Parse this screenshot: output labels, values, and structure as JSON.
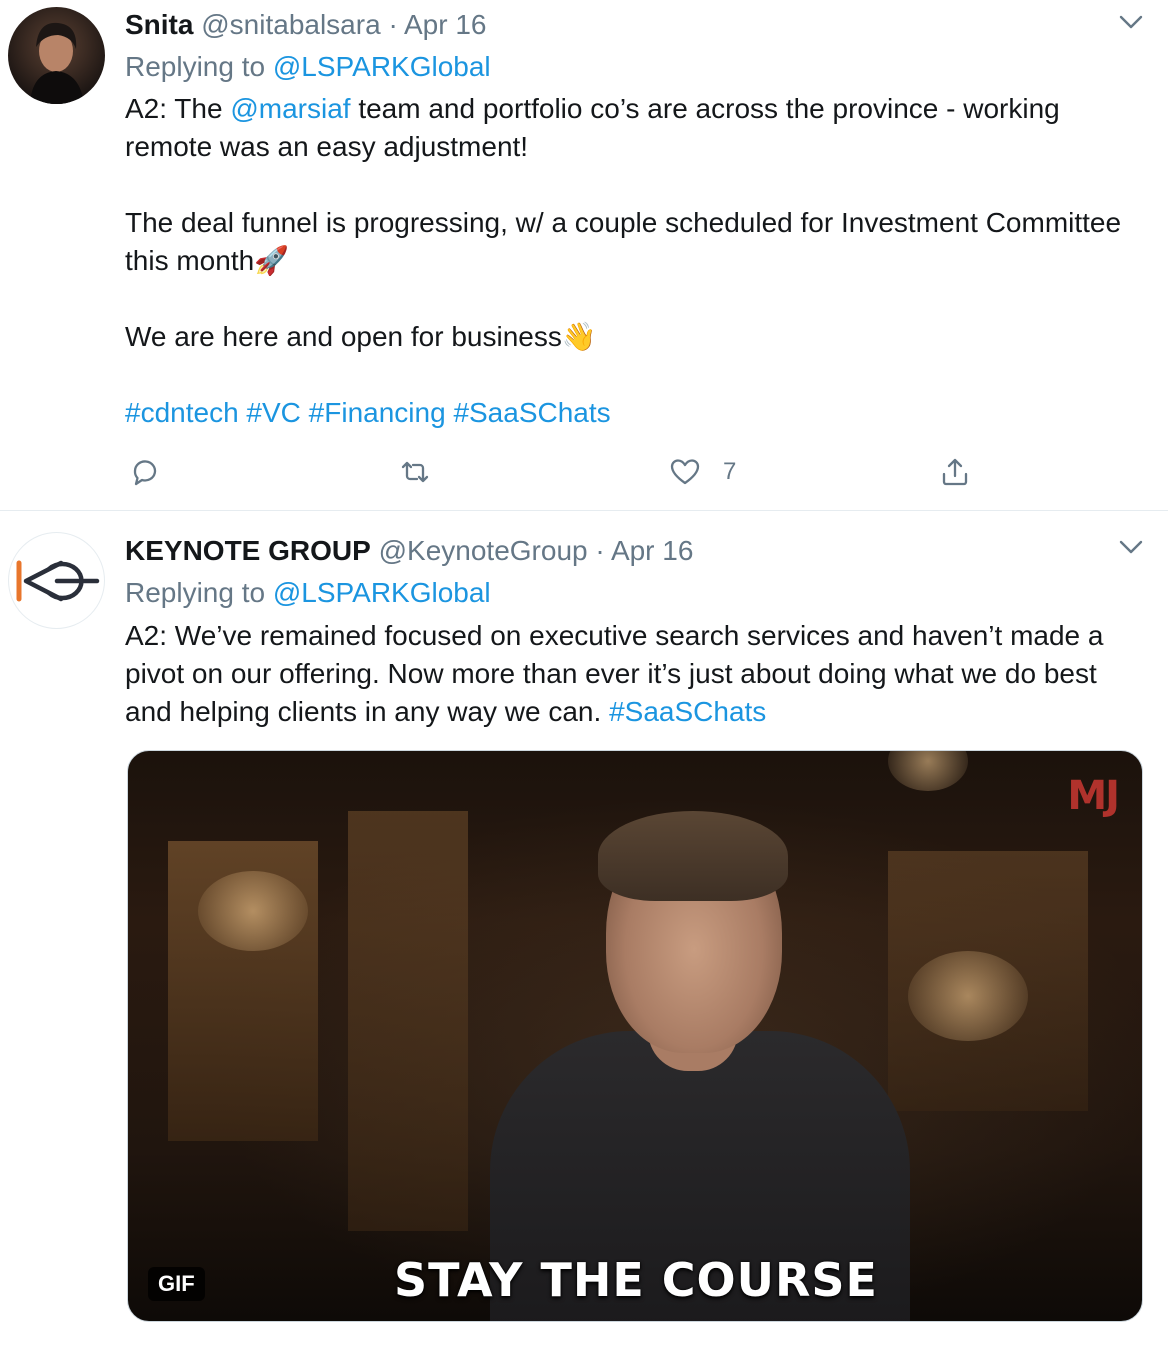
{
  "tweets": [
    {
      "author_name": "Snita",
      "handle": "@snitabalsara",
      "separator": "·",
      "date": "Apr 16",
      "replying_prefix": "Replying to",
      "replying_to": "@LSPARKGlobal",
      "line1_pre": "A2: The ",
      "line1_mention": "@marsiaf",
      "line1_post": " team and portfolio co’s are across the province - working remote was an easy adjustment!",
      "para2": "The deal funnel is progressing, w/ a couple scheduled for Investment Committee this month",
      "para2_emoji": "🚀",
      "para3": "We are here and open for business",
      "para3_emoji": "👋",
      "hashtags": [
        "#cdntech",
        "#VC",
        "#Financing",
        "#SaaSChats"
      ],
      "like_count": "7",
      "icons": [
        "reply-icon",
        "retweet-icon",
        "heart-icon",
        "share-icon",
        "chevron-down-icon"
      ]
    },
    {
      "author_name": "KEYNOTE GROUP",
      "handle": "@KeynoteGroup",
      "separator": "·",
      "date": "Apr 16",
      "replying_prefix": "Replying to",
      "replying_to": "@LSPARKGlobal",
      "text": "A2: We’ve remained focused on executive search services and haven’t made a pivot on our offering. Now more than ever it’s just about doing what we do best and helping clients in any way we can.  ",
      "hashtag": "#SaaSChats",
      "media": {
        "badge": "GIF",
        "caption": "STAY THE COURSE",
        "watermark": "MJ"
      }
    }
  ],
  "colors": {
    "link": "#1b95e0",
    "muted": "#657786",
    "text": "#14171a",
    "logo_orange": "#e8762c",
    "logo_dark": "#2a2f3a"
  }
}
